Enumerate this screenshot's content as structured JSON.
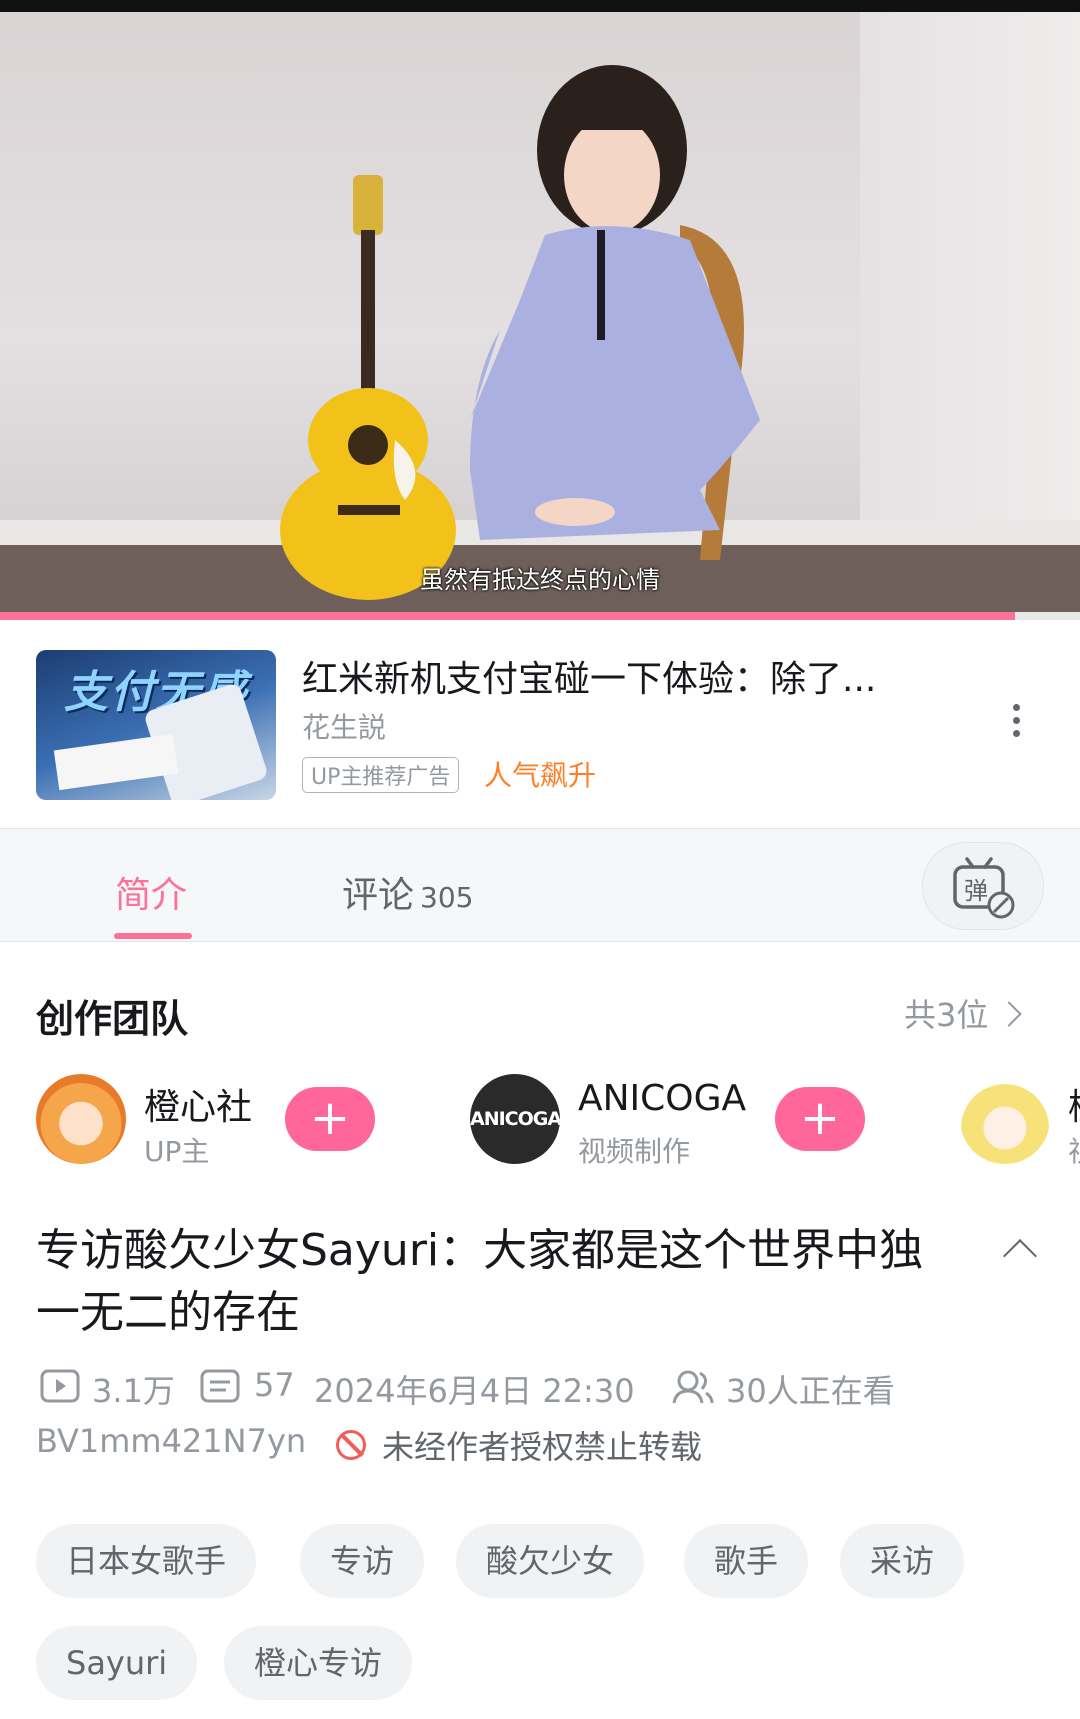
{
  "video": {
    "subtitle": "虽然有抵达终点的心情",
    "progress": 0.94
  },
  "ad": {
    "thumb_text": "支付无感",
    "title": "红米新机支付宝碰一下体验：除了...",
    "author": "花生説",
    "badge": "UP主推荐广告",
    "hot": "人气飙升"
  },
  "tabs": {
    "intro": "简介",
    "comments": "评论",
    "comments_count": "305",
    "danmaku_icon": "弹"
  },
  "team": {
    "title": "创作团队",
    "count": "共3位",
    "members": [
      {
        "name": "橙心社",
        "role": "UP主"
      },
      {
        "name": "ANICOGA",
        "role": "视频制作",
        "avatar_text": "ANICOGA"
      },
      {
        "name": "橙",
        "role": "视"
      }
    ]
  },
  "video_info": {
    "title": "专访酸欠少女Sayuri：大家都是这个世界中独一无二的存在",
    "views": "3.1万",
    "danmaku": "57",
    "datetime": "2024年6月4日 22:30",
    "watching": "30人正在看",
    "bvid": "BV1mm421N7yn",
    "no_repost": "未经作者授权禁止转载"
  },
  "tags": [
    "日本女歌手",
    "专访",
    "酸欠少女",
    "歌手",
    "采访",
    "Sayuri",
    "橙心专访"
  ],
  "colors": {
    "accent": "#fb7299",
    "follow": "#ff6699",
    "hot": "#ff7f24",
    "warn": "#f25d59"
  }
}
